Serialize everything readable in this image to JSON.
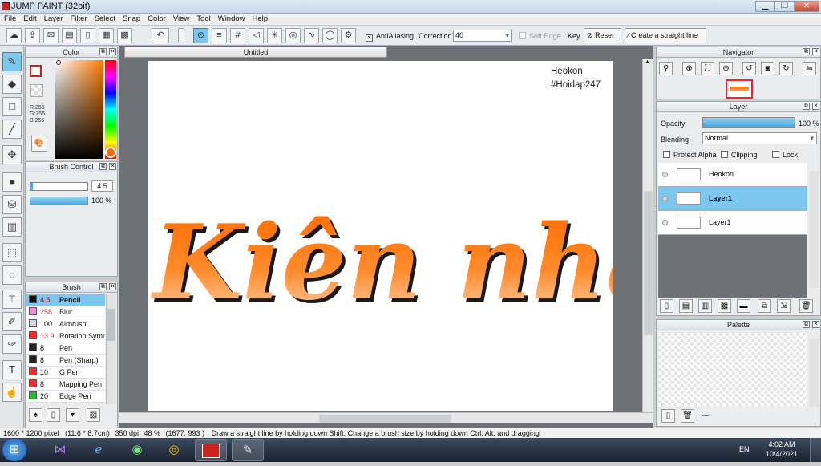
{
  "window": {
    "title": "JUMP PAINT (32bit)",
    "min": "▁",
    "max": "❐",
    "close": "✕"
  },
  "menu": [
    "File",
    "Edit",
    "Layer",
    "Filter",
    "Select",
    "Snap",
    "Color",
    "View",
    "Tool",
    "Window",
    "Help"
  ],
  "toolbar": {
    "antialias_label": "AntiAliasing",
    "correction_label": "Correction",
    "correction_value": "40",
    "soft_edge_label": "Soft Edge",
    "key_label": "Key",
    "reset_label": "Reset",
    "straight_line_label": "Create a straight line"
  },
  "color_panel": {
    "title": "Color",
    "r": "R:255",
    "g": "G:255",
    "b": "B:255"
  },
  "brush_control": {
    "title": "Brush Control",
    "size": "4.5",
    "opacity": "100 %"
  },
  "brush_panel": {
    "title": "Brush",
    "items": [
      {
        "size": "4.5",
        "name": "Pencil",
        "color": "#111111"
      },
      {
        "size": "258",
        "name": "Blur",
        "color": "#f28ee0"
      },
      {
        "size": "100",
        "name": "Airbrush",
        "color": "#d9d9d9"
      },
      {
        "size": "13.9",
        "name": "Rotation Symm",
        "color": "#ff2a2a"
      },
      {
        "size": "8",
        "name": "Pen",
        "color": "#222222"
      },
      {
        "size": "8",
        "name": "Pen (Sharp)",
        "color": "#222222"
      },
      {
        "size": "10",
        "name": "G Pen",
        "color": "#ff2a2a"
      },
      {
        "size": "8",
        "name": "Mapping Pen",
        "color": "#ff2a2a"
      },
      {
        "size": "20",
        "name": "Edge Pen",
        "color": "#22bb22"
      }
    ]
  },
  "document": {
    "tab_title": "Untitled",
    "watermark_line1": "Heokon",
    "watermark_line2": "#Hoidap247",
    "artwork_text": "Kiên nhẫn"
  },
  "navigator": {
    "title": "Navigator"
  },
  "layer_panel": {
    "title": "Layer",
    "opacity_label": "Opacity",
    "opacity_value": "100 %",
    "opacity_fraction": 1.0,
    "blending_label": "Blending",
    "blending_value": "Normal",
    "protect_alpha": "Protect Alpha",
    "clipping": "Clipping",
    "lock": "Lock",
    "layers": [
      {
        "name": "Heokon",
        "selected": false
      },
      {
        "name": "Layer1",
        "selected": true
      },
      {
        "name": "Layer1",
        "selected": false
      }
    ]
  },
  "palette": {
    "title": "Palette",
    "dash": "---"
  },
  "status": {
    "dims": "1600 * 1200 pixel",
    "size": "(11.6 * 8.7cm)",
    "dpi": "350 dpi",
    "zoom": "48 %",
    "coords": "(1677, 993 )",
    "hint": "Draw a straight line by holding down Shift, Change a brush size by holding down Ctrl, Alt, and dragging"
  },
  "taskbar": {
    "lang": "EN",
    "time": "4:02 AM",
    "date": "10/4/2021"
  },
  "accent": "#7dc7ef"
}
